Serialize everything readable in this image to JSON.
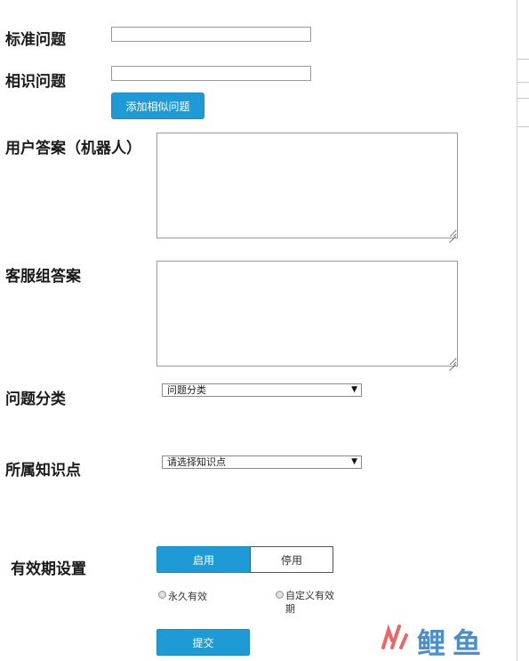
{
  "labels": {
    "standard_question": "标准问题",
    "similar_question": "相识问题",
    "user_answer": "用户答案（机器人）",
    "service_answer": "客服组答案",
    "category": "问题分类",
    "knowledge_point": "所属知识点",
    "validity": "有效期设置"
  },
  "inputs": {
    "standard_question_value": "",
    "similar_question_value": "",
    "user_answer_value": "",
    "service_answer_value": ""
  },
  "buttons": {
    "add_similar": "添加相似问题",
    "enable": "启用",
    "disable": "停用",
    "submit": "提交"
  },
  "selects": {
    "category": "问题分类",
    "knowledge_point": "请选择知识点"
  },
  "radios": {
    "permanent": "永久有效",
    "custom_line1": "自定义有效",
    "custom_line2": "期"
  },
  "watermark": {
    "text": "鲤鱼",
    "colors": {
      "red": "#e84c4c",
      "blue": "#2a7cc7",
      "green": "#3ab07a"
    }
  },
  "colors": {
    "accent": "#1e9bd7"
  }
}
